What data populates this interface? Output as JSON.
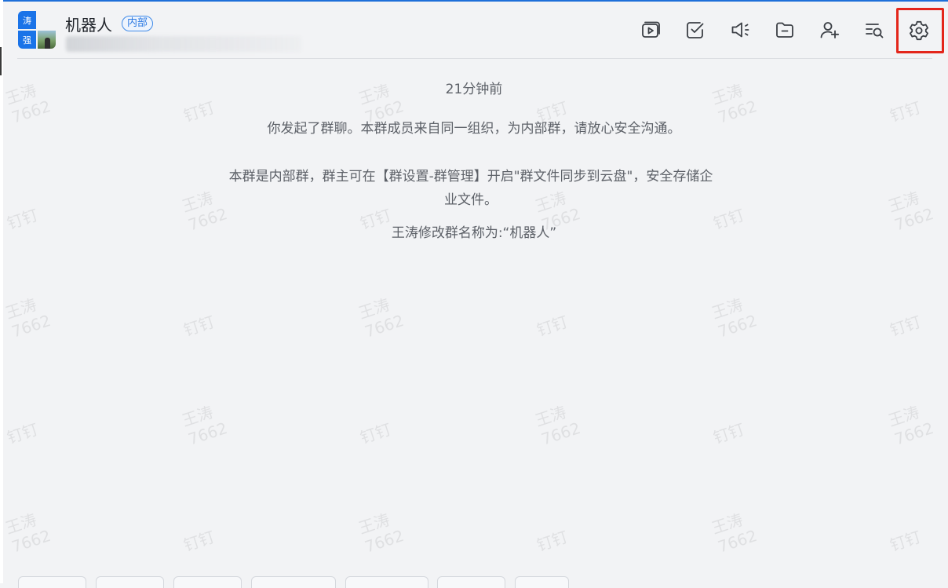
{
  "header": {
    "title": "机器人",
    "tag": "内部",
    "avatar": {
      "tile_1": "涛",
      "tile_2": "强"
    }
  },
  "toolbar": {
    "items": [
      {
        "name": "media",
        "icon": "video-play-icon"
      },
      {
        "name": "todo",
        "icon": "checkbox-icon"
      },
      {
        "name": "announcement",
        "icon": "speaker-icon"
      },
      {
        "name": "files",
        "icon": "folder-icon"
      },
      {
        "name": "add-member",
        "icon": "add-user-icon"
      },
      {
        "name": "search-history",
        "icon": "list-search-icon"
      },
      {
        "name": "settings",
        "icon": "gear-icon"
      }
    ],
    "highlighted": "settings"
  },
  "messages": {
    "timestamp": "21分钟前",
    "system_1": "你发起了群聊。本群成员来自同一组织，为内部群，请放心安全沟通。",
    "system_2": "本群是内部群，群主可在【群设置-群管理】开启\"群文件同步到云盘\"，安全存储企业文件。",
    "system_3": "王涛修改群名称为:“机器人”"
  },
  "watermark": {
    "name": "王涛",
    "id": "7662",
    "app": "钉钉"
  },
  "colors": {
    "background": "#f2f3f5",
    "accent": "#1e6fd9",
    "tag_border": "#3f8ae8",
    "highlight": "#e3261b"
  }
}
